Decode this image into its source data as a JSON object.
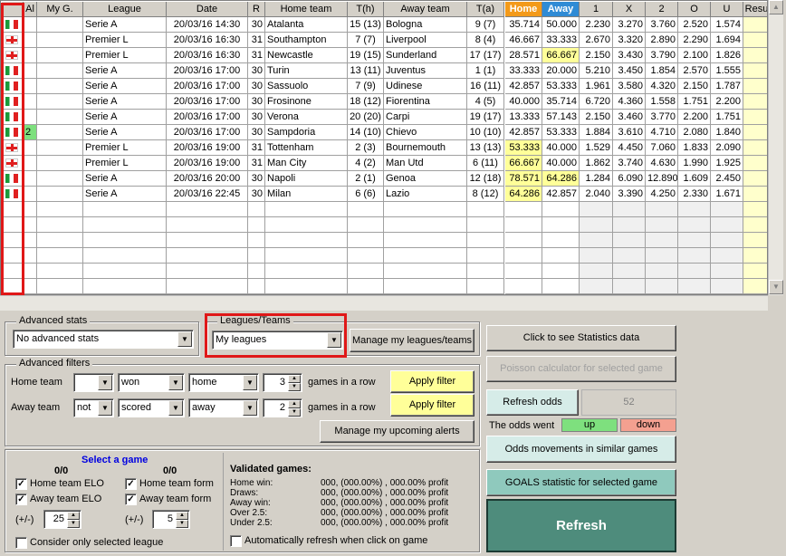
{
  "grid": {
    "columns": [
      "",
      "Al",
      "My G.",
      "League",
      "Date",
      "R",
      "Home team",
      "T(h)",
      "Away team",
      "T(a)",
      "Home",
      "Away",
      "1",
      "X",
      "2",
      "O",
      "U",
      "Resu"
    ],
    "rows": [
      {
        "flag": "it",
        "al": "",
        "league": "Serie A",
        "date": "20/03/16 14:30",
        "r": "30",
        "home": "Atalanta",
        "th": "15 (13)",
        "away": "Bologna",
        "ta": "9 (7)",
        "hp": "35.714",
        "ap": "50.000",
        "o1": "2.230",
        "ox": "3.270",
        "o2": "3.760",
        "oo": "2.520",
        "ou": "1.574",
        "hy": false,
        "ay": false
      },
      {
        "flag": "en",
        "al": "",
        "league": "Premier L",
        "date": "20/03/16 16:30",
        "r": "31",
        "home": "Southampton",
        "th": "7 (7)",
        "away": "Liverpool",
        "ta": "8 (4)",
        "hp": "46.667",
        "ap": "33.333",
        "o1": "2.670",
        "ox": "3.320",
        "o2": "2.890",
        "oo": "2.290",
        "ou": "1.694",
        "hy": false,
        "ay": false
      },
      {
        "flag": "en",
        "al": "",
        "league": "Premier L",
        "date": "20/03/16 16:30",
        "r": "31",
        "home": "Newcastle",
        "th": "19 (15)",
        "away": "Sunderland",
        "ta": "17 (17)",
        "hp": "28.571",
        "ap": "66.667",
        "o1": "2.150",
        "ox": "3.430",
        "o2": "3.790",
        "oo": "2.100",
        "ou": "1.826",
        "hy": false,
        "ay": true
      },
      {
        "flag": "it",
        "al": "",
        "league": "Serie A",
        "date": "20/03/16 17:00",
        "r": "30",
        "home": "Turin",
        "th": "13 (11)",
        "away": "Juventus",
        "ta": "1 (1)",
        "hp": "33.333",
        "ap": "20.000",
        "o1": "5.210",
        "ox": "3.450",
        "o2": "1.854",
        "oo": "2.570",
        "ou": "1.555",
        "hy": false,
        "ay": false
      },
      {
        "flag": "it",
        "al": "",
        "league": "Serie A",
        "date": "20/03/16 17:00",
        "r": "30",
        "home": "Sassuolo",
        "th": "7 (9)",
        "away": "Udinese",
        "ta": "16 (11)",
        "hp": "42.857",
        "ap": "53.333",
        "o1": "1.961",
        "ox": "3.580",
        "o2": "4.320",
        "oo": "2.150",
        "ou": "1.787",
        "hy": false,
        "ay": false
      },
      {
        "flag": "it",
        "al": "",
        "league": "Serie A",
        "date": "20/03/16 17:00",
        "r": "30",
        "home": "Frosinone",
        "th": "18 (12)",
        "away": "Fiorentina",
        "ta": "4 (5)",
        "hp": "40.000",
        "ap": "35.714",
        "o1": "6.720",
        "ox": "4.360",
        "o2": "1.558",
        "oo": "1.751",
        "ou": "2.200",
        "hy": false,
        "ay": false
      },
      {
        "flag": "it",
        "al": "",
        "league": "Serie A",
        "date": "20/03/16 17:00",
        "r": "30",
        "home": "Verona",
        "th": "20 (20)",
        "away": "Carpi",
        "ta": "19 (17)",
        "hp": "13.333",
        "ap": "57.143",
        "o1": "2.150",
        "ox": "3.460",
        "o2": "3.770",
        "oo": "2.200",
        "ou": "1.751",
        "hy": false,
        "ay": false
      },
      {
        "flag": "it",
        "al": "2",
        "league": "Serie A",
        "date": "20/03/16 17:00",
        "r": "30",
        "home": "Sampdoria",
        "th": "14 (10)",
        "away": "Chievo",
        "ta": "10 (10)",
        "hp": "42.857",
        "ap": "53.333",
        "o1": "1.884",
        "ox": "3.610",
        "o2": "4.710",
        "oo": "2.080",
        "ou": "1.840",
        "hy": false,
        "ay": false
      },
      {
        "flag": "en",
        "al": "",
        "league": "Premier L",
        "date": "20/03/16 19:00",
        "r": "31",
        "home": "Tottenham",
        "th": "2 (3)",
        "away": "Bournemouth",
        "ta": "13 (13)",
        "hp": "53.333",
        "ap": "40.000",
        "o1": "1.529",
        "ox": "4.450",
        "o2": "7.060",
        "oo": "1.833",
        "ou": "2.090",
        "hy": true,
        "ay": false
      },
      {
        "flag": "en",
        "al": "",
        "league": "Premier L",
        "date": "20/03/16 19:00",
        "r": "31",
        "home": "Man City",
        "th": "4 (2)",
        "away": "Man Utd",
        "ta": "6 (11)",
        "hp": "66.667",
        "ap": "40.000",
        "o1": "1.862",
        "ox": "3.740",
        "o2": "4.630",
        "oo": "1.990",
        "ou": "1.925",
        "hy": true,
        "ay": false
      },
      {
        "flag": "it",
        "al": "",
        "league": "Serie A",
        "date": "20/03/16 20:00",
        "r": "30",
        "home": "Napoli",
        "th": "2 (1)",
        "away": "Genoa",
        "ta": "12 (18)",
        "hp": "78.571",
        "ap": "64.286",
        "o1": "1.284",
        "ox": "6.090",
        "o2": "12.890",
        "oo": "1.609",
        "ou": "2.450",
        "hy": true,
        "ay": true
      },
      {
        "flag": "it",
        "al": "",
        "league": "Serie A",
        "date": "20/03/16 22:45",
        "r": "30",
        "home": "Milan",
        "th": "6 (6)",
        "away": "Lazio",
        "ta": "8 (12)",
        "hp": "64.286",
        "ap": "42.857",
        "o1": "2.040",
        "ox": "3.390",
        "o2": "4.250",
        "oo": "2.330",
        "ou": "1.671",
        "hy": true,
        "ay": false
      }
    ]
  },
  "advanced_stats": {
    "label": "Advanced stats",
    "value": "No advanced stats"
  },
  "leagues_teams": {
    "label": "Leagues/Teams",
    "value": "My leagues",
    "manage": "Manage my leagues/teams"
  },
  "advanced_filters": {
    "label": "Advanced filters",
    "home_label": "Home team",
    "home_op": "",
    "home_what": "won",
    "home_where": "home",
    "home_n": "3",
    "home_suffix": "games in a row",
    "home_apply": "Apply filter",
    "away_label": "Away team",
    "away_op": "not",
    "away_what": "scored",
    "away_where": "away",
    "away_n": "2",
    "away_suffix": "games in a row",
    "away_apply": "Apply filter",
    "alerts": "Manage my upcoming alerts"
  },
  "right": {
    "stats": "Click to see Statistics data",
    "poisson": "Poisson calculator for selected game",
    "refresh_odds": "Refresh odds",
    "odds_count": "52",
    "odds_went": "The odds went",
    "up": "up",
    "down": "down",
    "odds_movements": "Odds movements in similar games",
    "goals": "GOALS statistic for selected game",
    "refresh": "Refresh"
  },
  "select_game": {
    "title": "Select a game",
    "left_count": "0/0",
    "right_count": "0/0",
    "home_elo": "Home team ELO",
    "away_elo": "Away team ELO",
    "home_form": "Home team form",
    "away_form": "Away team form",
    "pm_label": "(+/-)",
    "elo_val": "25",
    "form_val": "5",
    "consider": "Consider only selected league",
    "validated_title": "Validated games:",
    "home_win": "Home win:",
    "draws": "Draws:",
    "away_win": "Away win:",
    "over": "Over 2.5:",
    "under": "Under 2.5:",
    "v_home": "000, (000.00%) , 000.00% profit",
    "v_draws": "000, (000.00%) , 000.00% profit",
    "v_away": "000, (000.00%) , 000.00% profit",
    "v_over": "000, (000.00%) , 000.00% profit",
    "v_under": "000, (000.00%) , 000.00% profit",
    "auto_refresh": "Automatically refresh when click on game"
  },
  "colors": {
    "accent_red": "#e01818",
    "home_header": "#f39a1a",
    "away_header": "#2f8bd5",
    "highlight": "#ffff99",
    "refresh_btn": "#4e8c7c",
    "up": "#7ee07e",
    "down": "#f4a090"
  }
}
